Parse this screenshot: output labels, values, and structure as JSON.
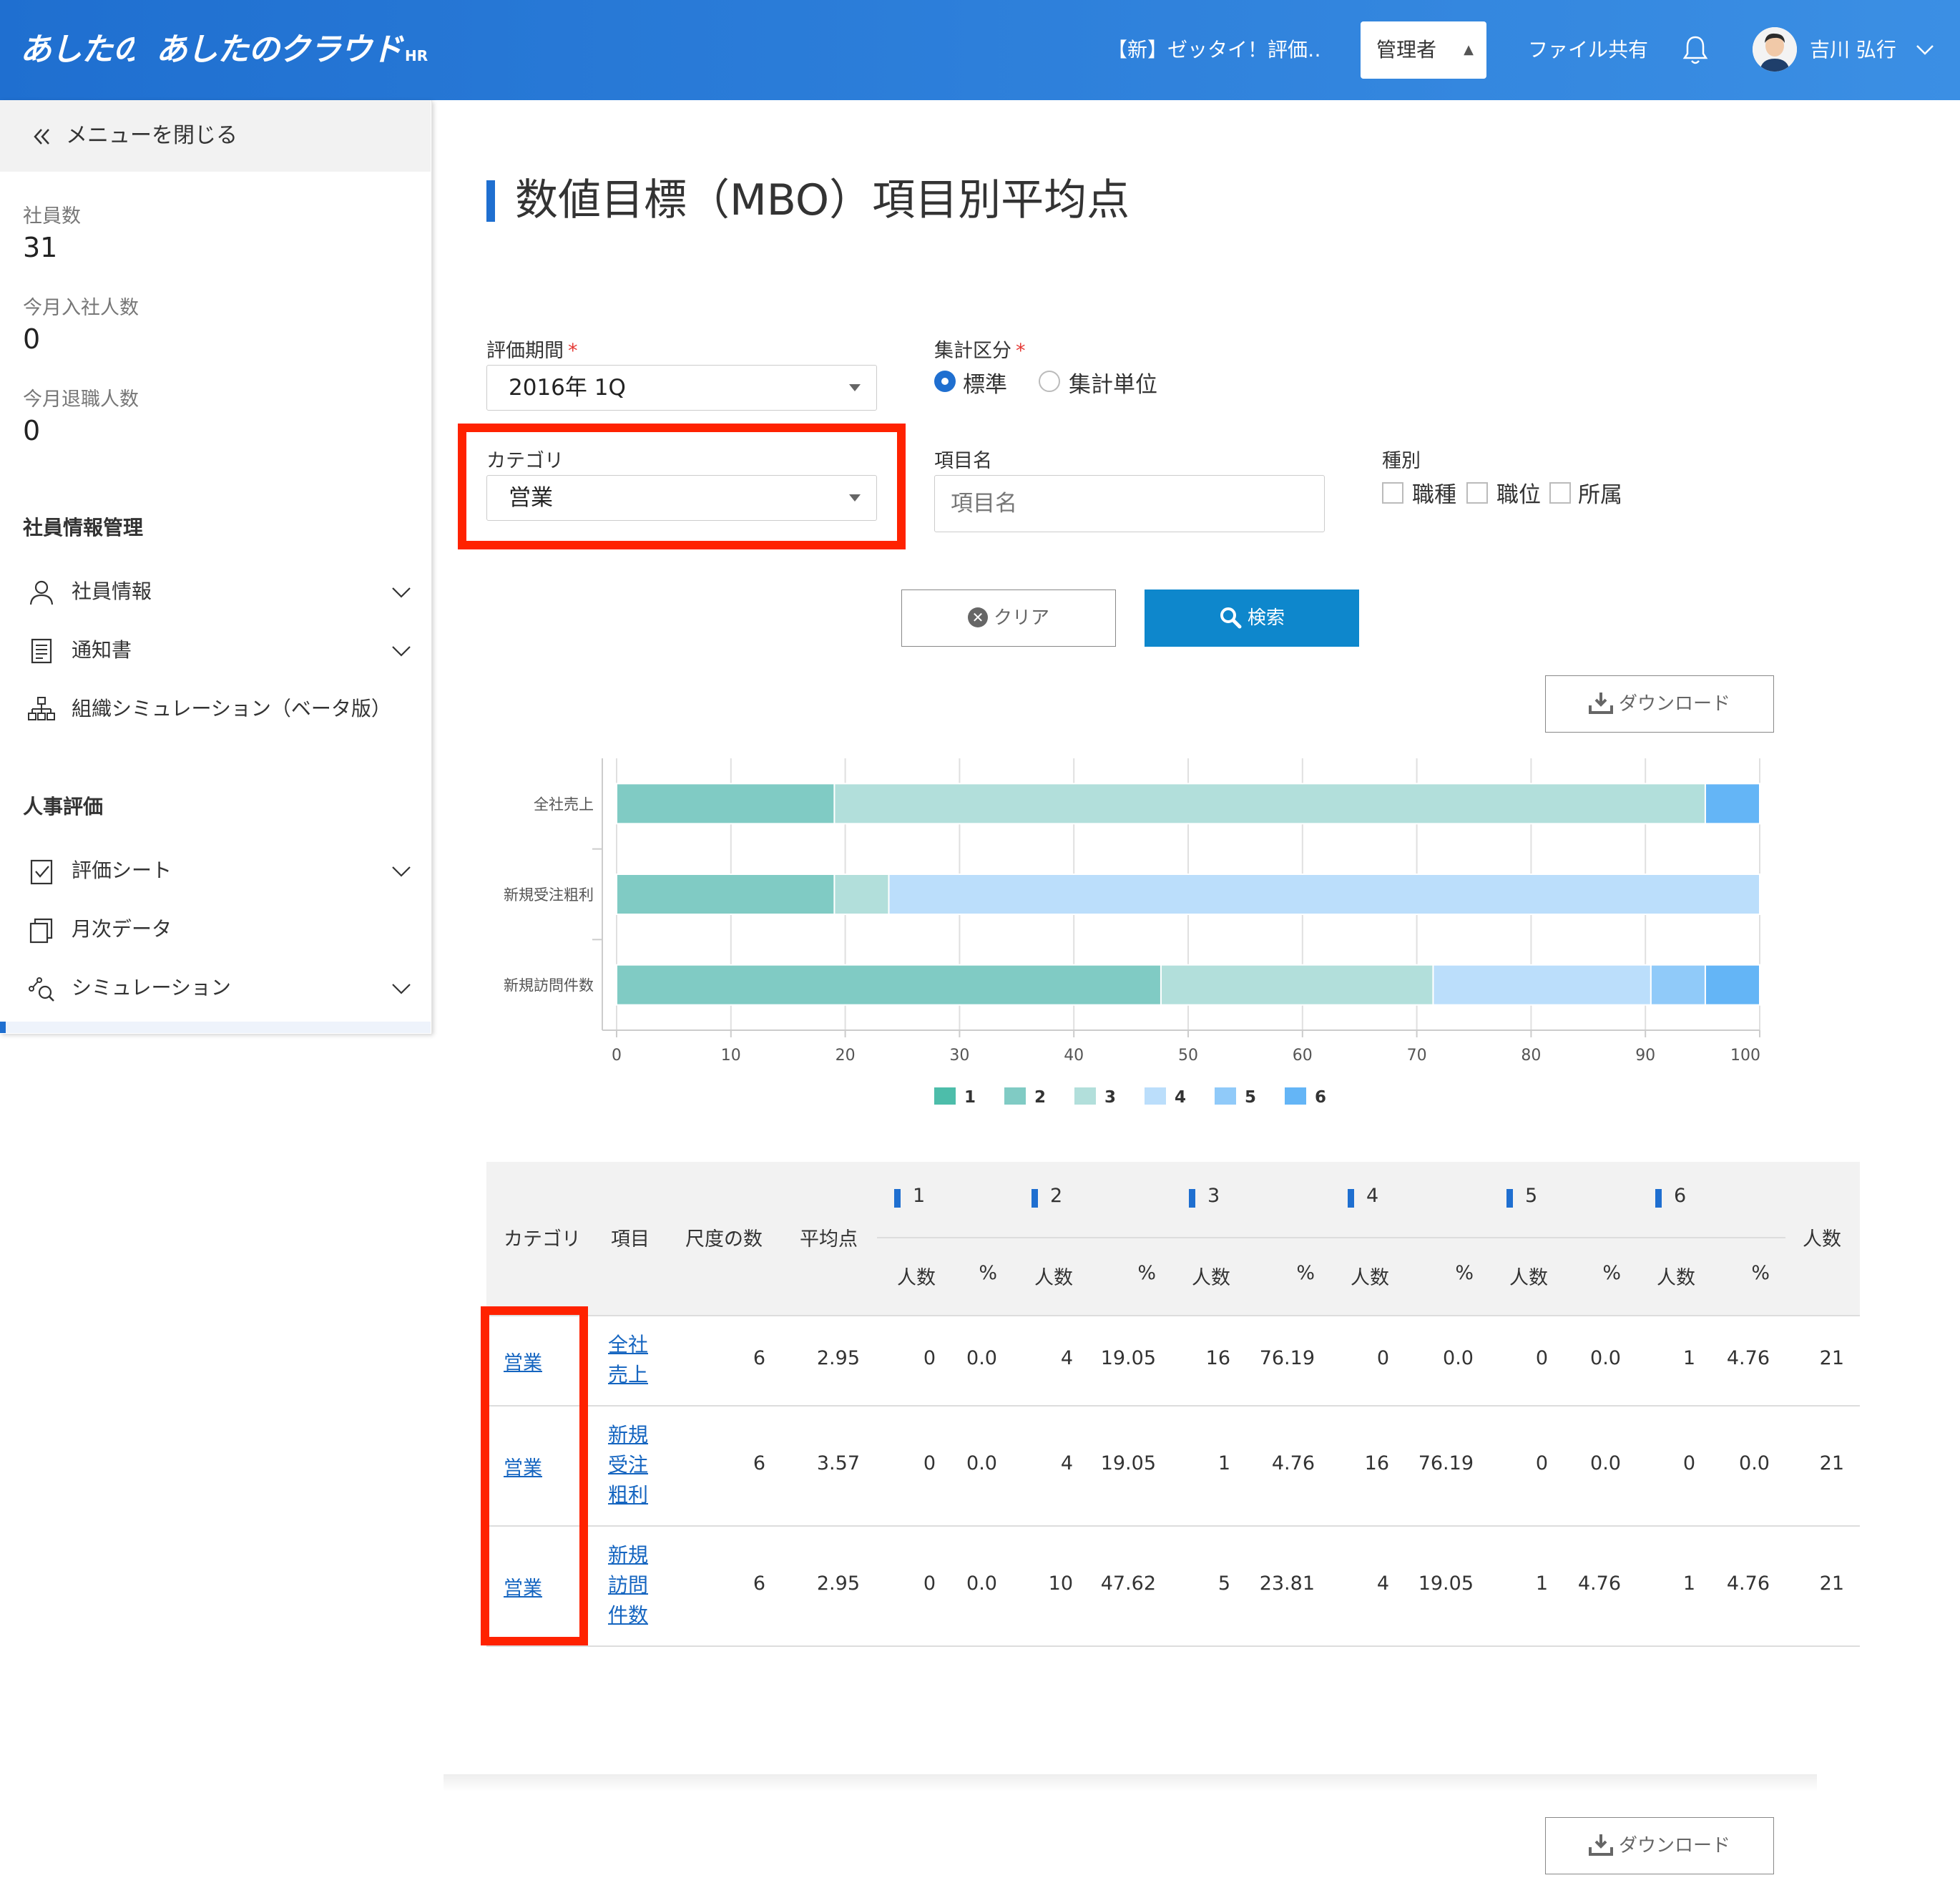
{
  "header": {
    "logo_text_1": "あしたの",
    "logo_text_2": "あしたのクラウド",
    "logo_suffix": "HR",
    "company": "【新】ゼッタイ！評価…",
    "role": "管理者",
    "file_share": "ファイル共有",
    "user_name": "吉川 弘行",
    "colors": {
      "header_start": "#1f6fd0",
      "header_end": "#3b8fe4"
    }
  },
  "sidebar": {
    "close_menu": "メニューを閉じる",
    "stats": [
      {
        "label": "社員数",
        "value": "31"
      },
      {
        "label": "今月入社人数",
        "value": "0"
      },
      {
        "label": "今月退職人数",
        "value": "0"
      }
    ],
    "sections": [
      {
        "heading": "社員情報管理",
        "items": [
          {
            "label": "社員情報",
            "icon": "person-icon",
            "expandable": true
          },
          {
            "label": "通知書",
            "icon": "document-icon",
            "expandable": true
          },
          {
            "label": "組織シミュレーション（ベータ版）",
            "icon": "org-chart-icon",
            "expandable": false
          }
        ]
      },
      {
        "heading": "人事評価",
        "items": [
          {
            "label": "評価シート",
            "icon": "checklist-icon",
            "expandable": true
          },
          {
            "label": "月次データ",
            "icon": "copy-icon",
            "expandable": false
          },
          {
            "label": "シミュレーション",
            "icon": "simulation-icon",
            "expandable": true
          }
        ]
      }
    ]
  },
  "page": {
    "title": "数値目標（MBO）項目別平均点"
  },
  "filters": {
    "period_label": "評価期間",
    "period_value": "2016年 1Q",
    "aggregation_label": "集計区分",
    "aggregation_options": [
      "標準",
      "集計単位"
    ],
    "aggregation_selected": "標準",
    "category_label": "カテゴリ",
    "category_value": "営業",
    "item_name_label": "項目名",
    "item_name_placeholder": "項目名",
    "type_label": "種別",
    "type_options": [
      "職種",
      "職位",
      "所属"
    ],
    "clear_label": "クリア",
    "search_label": "検索",
    "download_label": "ダウンロード"
  },
  "chart_data": {
    "type": "bar",
    "orientation": "horizontal",
    "stacked": true,
    "categories": [
      "全社売上",
      "新規受注粗利",
      "新規訪問件数"
    ],
    "series": [
      {
        "name": "1",
        "color": "#4dbdaa",
        "values": [
          0,
          0,
          0
        ]
      },
      {
        "name": "2",
        "color": "#80cbc4",
        "values": [
          19.05,
          19.05,
          47.62
        ]
      },
      {
        "name": "3",
        "color": "#b2dfdb",
        "values": [
          76.19,
          4.76,
          23.81
        ]
      },
      {
        "name": "4",
        "color": "#bbdefb",
        "values": [
          0,
          76.19,
          19.05
        ]
      },
      {
        "name": "5",
        "color": "#90caf9",
        "values": [
          0,
          0,
          4.76
        ]
      },
      {
        "name": "6",
        "color": "#64b5f6",
        "values": [
          4.76,
          0,
          4.76
        ]
      }
    ],
    "xlim": [
      0,
      100
    ],
    "xticks": [
      0,
      10,
      20,
      30,
      40,
      50,
      60,
      70,
      80,
      90,
      100
    ],
    "grid": true,
    "legend_position": "bottom"
  },
  "table": {
    "headers": {
      "category": "カテゴリ",
      "item": "項目",
      "scale_count": "尺度の数",
      "average": "平均点",
      "groups": [
        "1",
        "2",
        "3",
        "4",
        "5",
        "6"
      ],
      "people": "人数",
      "percent": "%",
      "total_people": "人数"
    },
    "rows": [
      {
        "category": "営業",
        "item_lines": [
          "全社",
          "売上"
        ],
        "scale_count": "6",
        "average": "2.95",
        "cells": [
          "0",
          "0.0",
          "4",
          "19.05",
          "16",
          "76.19",
          "0",
          "0.0",
          "0",
          "0.0",
          "1",
          "4.76"
        ],
        "total": "21"
      },
      {
        "category": "営業",
        "item_lines": [
          "新規",
          "受注",
          "粗利"
        ],
        "scale_count": "6",
        "average": "3.57",
        "cells": [
          "0",
          "0.0",
          "4",
          "19.05",
          "1",
          "4.76",
          "16",
          "76.19",
          "0",
          "0.0",
          "0",
          "0.0"
        ],
        "total": "21"
      },
      {
        "category": "営業",
        "item_lines": [
          "新規",
          "訪問",
          "件数"
        ],
        "scale_count": "6",
        "average": "2.95",
        "cells": [
          "0",
          "0.0",
          "10",
          "47.62",
          "5",
          "23.81",
          "4",
          "19.05",
          "1",
          "4.76",
          "1",
          "4.76"
        ],
        "total": "21"
      }
    ]
  }
}
